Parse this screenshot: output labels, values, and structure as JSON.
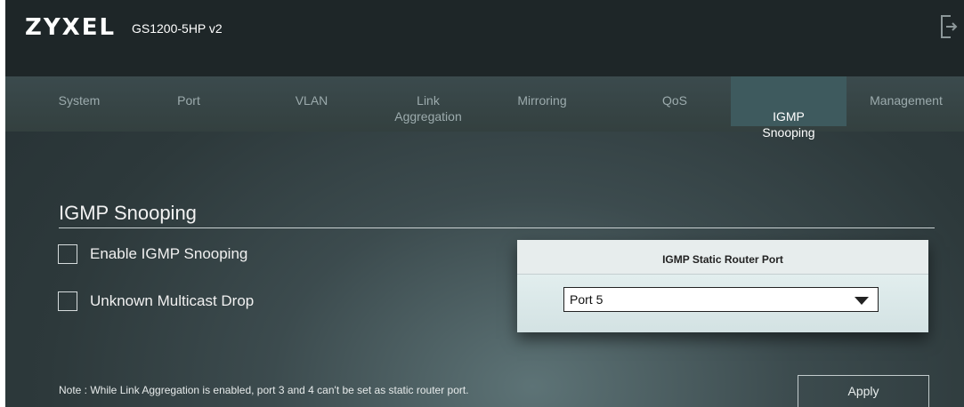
{
  "header": {
    "brand": "ZYXEL",
    "model": "GS1200-5HP v2",
    "logout_icon": "logout-icon"
  },
  "nav": {
    "tabs": [
      {
        "label": "System"
      },
      {
        "label": "Port"
      },
      {
        "label": "VLAN"
      },
      {
        "label": "Link\nAggregation"
      },
      {
        "label": "Mirroring"
      },
      {
        "label": "QoS"
      },
      {
        "label": "IGMP\nSnooping",
        "active": true
      },
      {
        "label": "Management"
      }
    ]
  },
  "main": {
    "title": "IGMP Snooping",
    "options": {
      "enable_label": "Enable IGMP Snooping",
      "enable_checked": false,
      "drop_label": "Unknown Multicast Drop",
      "drop_checked": false
    },
    "router_port": {
      "header": "IGMP Static Router Port",
      "selected": "Port 5"
    },
    "note": "Note : While Link Aggregation is enabled, port 3 and 4 can't be set as static router port.",
    "apply_label": "Apply"
  },
  "colors": {
    "background_dark": "#253033",
    "header_bar": "#1e2628",
    "active_tab": "#3e5a5e",
    "tab_text": "#9cabad"
  }
}
